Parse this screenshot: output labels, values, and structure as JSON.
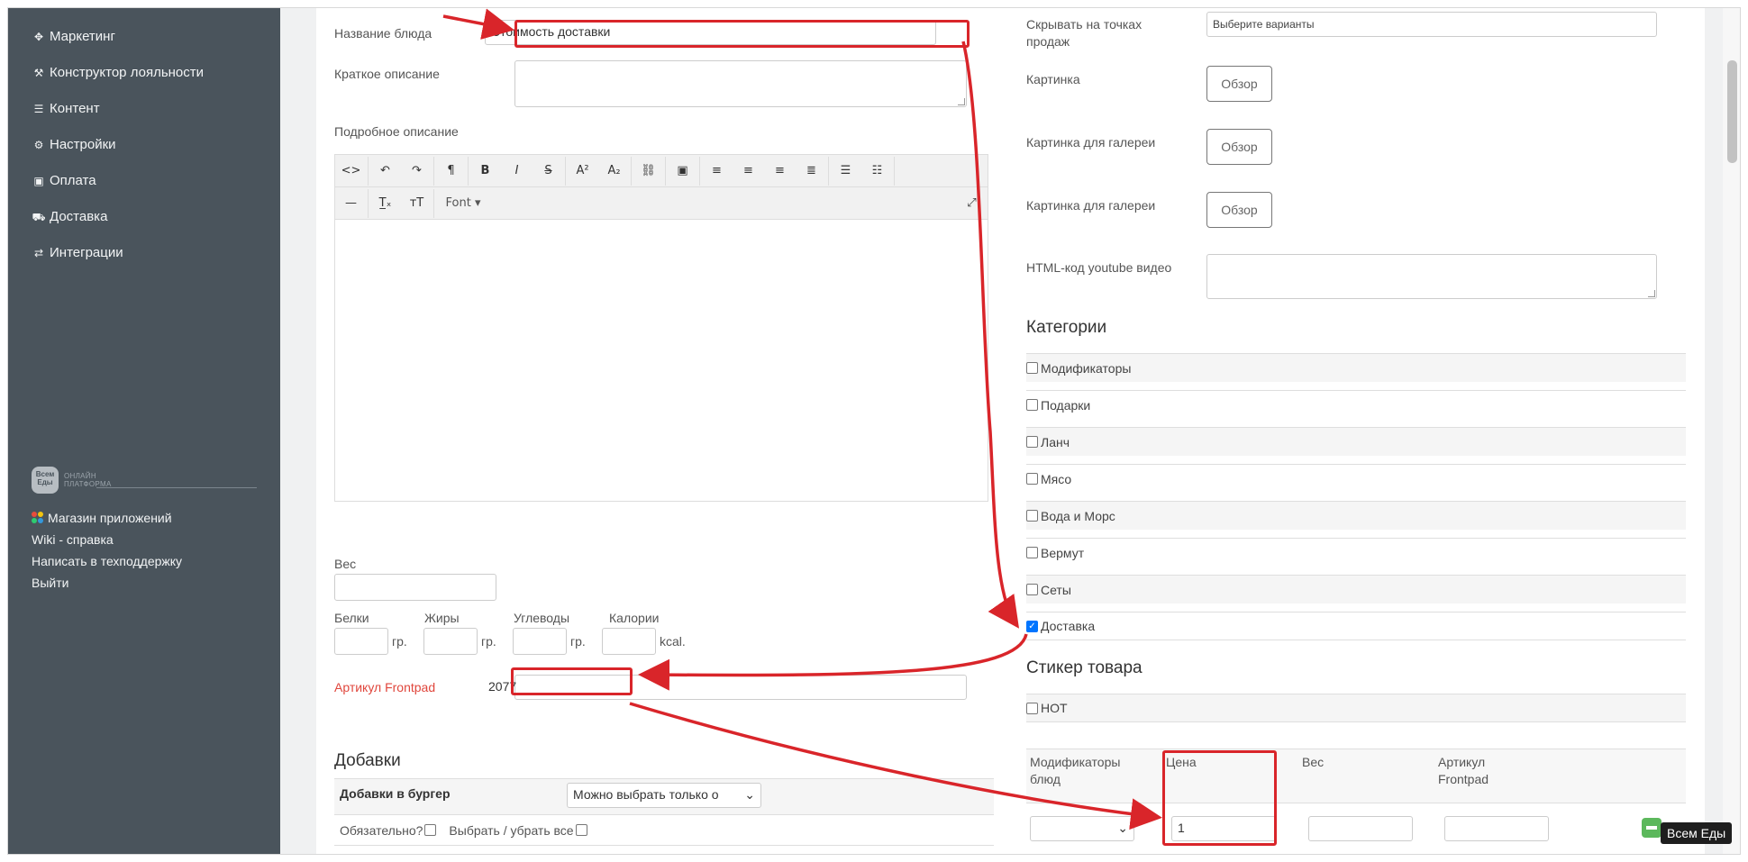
{
  "sidebar": {
    "items": [
      {
        "icon": "crosshair-icon",
        "glyph": "✥",
        "label": "Маркетинг"
      },
      {
        "icon": "magic-wand-icon",
        "glyph": "⚒",
        "label": "Конструктор лояльности"
      },
      {
        "icon": "list-icon",
        "glyph": "☰",
        "label": "Контент"
      },
      {
        "icon": "gear-icon",
        "glyph": "⚙",
        "label": "Настройки"
      },
      {
        "icon": "money-icon",
        "glyph": "▣",
        "label": "Оплата"
      },
      {
        "icon": "truck-icon",
        "glyph": "⛟",
        "label": "Доставка"
      },
      {
        "icon": "exchange-icon",
        "glyph": "⇄",
        "label": "Интеграции"
      }
    ],
    "logo": {
      "badge_top": "Всем",
      "badge_bottom": "Еды",
      "text_line1": "ОНЛАЙН",
      "text_line2": "ПЛАТФОРМА"
    },
    "links": {
      "app_store": "Магазин приложений",
      "wiki": "Wiki - справка",
      "support": "Написать в техподдержку",
      "logout": "Выйти"
    }
  },
  "form": {
    "dish_name_label": "Название блюда",
    "dish_name_value": "Стоимость доставки",
    "short_desc_label": "Краткое описание",
    "long_desc_label": "Подробное описание",
    "editor": {
      "font_label": "Font"
    },
    "weight_label": "Вес",
    "proteins_label": "Белки",
    "fats_label": "Жиры",
    "carbs_label": "Углеводы",
    "calories_label": "Калории",
    "unit_gr": "гр.",
    "unit_kcal": "kcal.",
    "frontpad_label": "Артикул Frontpad",
    "frontpad_value": "2077",
    "addons_title": "Добавки",
    "addon_group_name": "Добавки в бургер",
    "addon_select_value": "Можно выбрать только о",
    "required_label": "Обязательно?",
    "select_all_label": "Выбрать / убрать все"
  },
  "right": {
    "hide_label": "Скрывать на точках продаж",
    "hide_placeholder": "Выберите варианты",
    "image_label": "Картинка",
    "gallery_label_1": "Картинка для галереи",
    "gallery_label_2": "Картинка для галереи",
    "browse_label": "Обзор",
    "youtube_label": "HTML-код youtube видео",
    "categories_title": "Категории",
    "categories": [
      {
        "label": "Модификаторы",
        "checked": false
      },
      {
        "label": "Подарки",
        "checked": false
      },
      {
        "label": "Ланч",
        "checked": false
      },
      {
        "label": "Мясо",
        "checked": false
      },
      {
        "label": "Вода и Морс",
        "checked": false
      },
      {
        "label": "Вермут",
        "checked": false
      },
      {
        "label": "Сеты",
        "checked": false
      },
      {
        "label": "Доставка",
        "checked": true
      }
    ],
    "sticker_title": "Стикер товара",
    "sticker_option": "HOT",
    "mod_table": {
      "col_modifiers": "Модификаторы блюд",
      "col_price": "Цена",
      "col_weight": "Вес",
      "col_article": "Артикул Frontpad",
      "price_value": "1"
    }
  },
  "tooltip": "Всем Еды",
  "colors": {
    "sidebar": "#4a545c",
    "annotation_red": "#d9252a",
    "frontpad_label": "#e0463c",
    "remove_button": "#5cb85c"
  }
}
